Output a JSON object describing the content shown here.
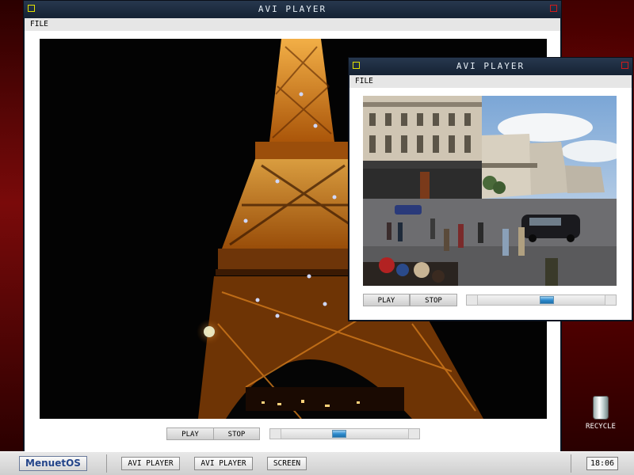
{
  "desktop": {
    "recycle_label": "RECYCLE"
  },
  "windows": [
    {
      "title": "AVI PLAYER",
      "menu": "FILE",
      "play_label": "PLAY",
      "stop_label": "STOP",
      "video": "eiffel-tower-night"
    },
    {
      "title": "AVI PLAYER",
      "menu": "FILE",
      "play_label": "PLAY",
      "stop_label": "STOP",
      "video": "paris-street-opera"
    }
  ],
  "taskbar": {
    "start_label": "MenuetOS",
    "tasks": [
      "AVI PLAYER",
      "AVI PLAYER",
      "SCREEN"
    ],
    "clock": "18:06"
  },
  "progress": {
    "main_position": 0.45,
    "secondary_position": 0.55
  },
  "colors": {
    "accent": "#2f8ccf",
    "title_bar": "#1d2b3d",
    "close_box": "#d11a1a",
    "minimize_box": "#e3e100",
    "desktop": "#5a0505"
  }
}
